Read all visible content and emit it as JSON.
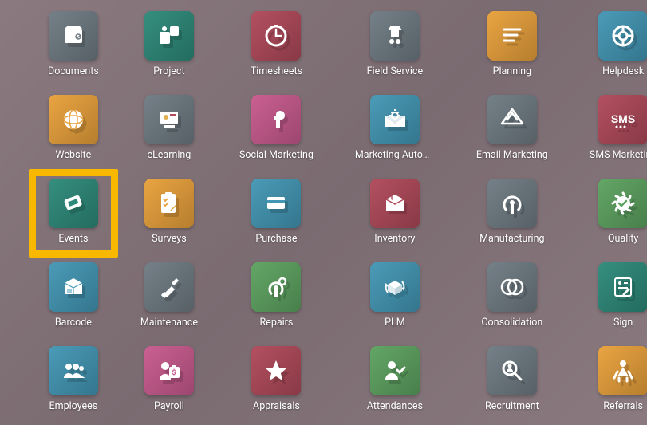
{
  "highlight_index": 12,
  "apps": [
    {
      "id": "documents",
      "label": "Documents",
      "color": "#6f7b83",
      "icon": "documents-icon"
    },
    {
      "id": "project",
      "label": "Project",
      "color": "#2d8a7a",
      "icon": "project-icon"
    },
    {
      "id": "timesheets",
      "label": "Timesheets",
      "color": "#b0495a",
      "icon": "timesheets-icon"
    },
    {
      "id": "field-service",
      "label": "Field Service",
      "color": "#6f7b83",
      "icon": "field-service-icon"
    },
    {
      "id": "planning",
      "label": "Planning",
      "color": "#e9a13b",
      "icon": "planning-icon"
    },
    {
      "id": "helpdesk",
      "label": "Helpdesk",
      "color": "#4397b5",
      "icon": "helpdesk-icon"
    },
    {
      "id": "website",
      "label": "Website",
      "color": "#e9a13b",
      "icon": "website-icon"
    },
    {
      "id": "elearning",
      "label": "eLearning",
      "color": "#6f7b83",
      "icon": "elearning-icon"
    },
    {
      "id": "social-marketing",
      "label": "Social Marketing",
      "color": "#c85a8e",
      "icon": "social-marketing-icon"
    },
    {
      "id": "marketing-automation",
      "label": "Marketing Autom...",
      "color": "#4397b5",
      "icon": "marketing-automation-icon"
    },
    {
      "id": "email-marketing",
      "label": "Email Marketing",
      "color": "#6f7b83",
      "icon": "email-marketing-icon"
    },
    {
      "id": "sms-marketing",
      "label": "SMS Marketing",
      "color": "#b0495a",
      "icon": "sms-marketing-icon"
    },
    {
      "id": "events",
      "label": "Events",
      "color": "#2d8a7a",
      "icon": "events-icon"
    },
    {
      "id": "surveys",
      "label": "Surveys",
      "color": "#e9a13b",
      "icon": "surveys-icon"
    },
    {
      "id": "purchase",
      "label": "Purchase",
      "color": "#4397b5",
      "icon": "purchase-icon"
    },
    {
      "id": "inventory",
      "label": "Inventory",
      "color": "#b0495a",
      "icon": "inventory-icon"
    },
    {
      "id": "manufacturing",
      "label": "Manufacturing",
      "color": "#6f7b83",
      "icon": "manufacturing-icon"
    },
    {
      "id": "quality",
      "label": "Quality",
      "color": "#5da360",
      "icon": "quality-icon"
    },
    {
      "id": "barcode",
      "label": "Barcode",
      "color": "#4397b5",
      "icon": "barcode-icon"
    },
    {
      "id": "maintenance",
      "label": "Maintenance",
      "color": "#6f7b83",
      "icon": "maintenance-icon"
    },
    {
      "id": "repairs",
      "label": "Repairs",
      "color": "#5da360",
      "icon": "repairs-icon"
    },
    {
      "id": "plm",
      "label": "PLM",
      "color": "#4397b5",
      "icon": "plm-icon"
    },
    {
      "id": "consolidation",
      "label": "Consolidation",
      "color": "#6f7b83",
      "icon": "consolidation-icon"
    },
    {
      "id": "sign",
      "label": "Sign",
      "color": "#2d8a7a",
      "icon": "sign-icon"
    },
    {
      "id": "employees",
      "label": "Employees",
      "color": "#4397b5",
      "icon": "employees-icon"
    },
    {
      "id": "payroll",
      "label": "Payroll",
      "color": "#c85a8e",
      "icon": "payroll-icon"
    },
    {
      "id": "appraisals",
      "label": "Appraisals",
      "color": "#b0495a",
      "icon": "appraisals-icon"
    },
    {
      "id": "attendances",
      "label": "Attendances",
      "color": "#5da360",
      "icon": "attendances-icon"
    },
    {
      "id": "recruitment",
      "label": "Recruitment",
      "color": "#6f7b83",
      "icon": "recruitment-icon"
    },
    {
      "id": "referrals",
      "label": "Referrals",
      "color": "#e9a13b",
      "icon": "referrals-icon"
    }
  ]
}
